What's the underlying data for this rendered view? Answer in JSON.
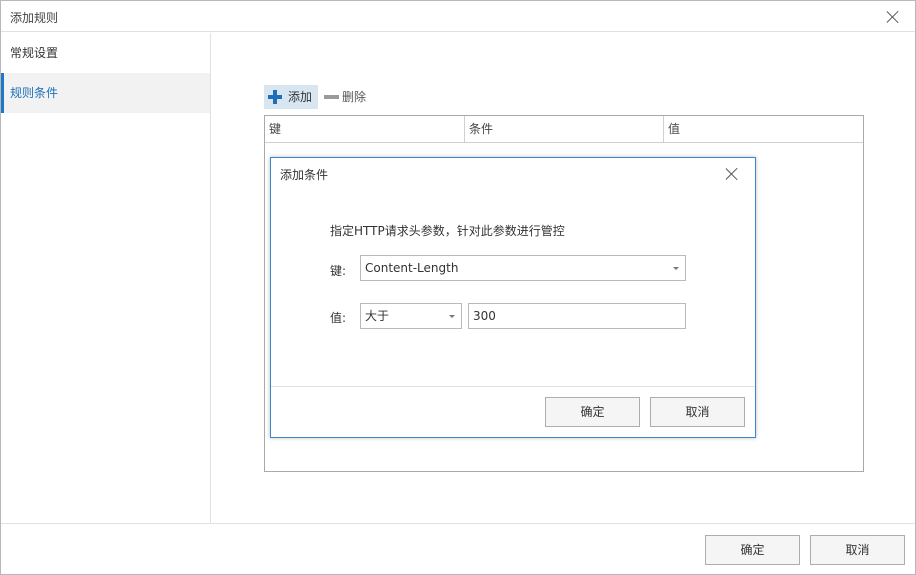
{
  "window": {
    "title": "添加规则",
    "close_icon": "close-icon"
  },
  "sidebar": {
    "items": [
      {
        "label": "常规设置",
        "active": false
      },
      {
        "label": "规则条件",
        "active": true
      }
    ]
  },
  "toolbar": {
    "add_label": "添加",
    "add_icon": "plus-icon",
    "delete_label": "删除",
    "delete_icon": "minus-icon"
  },
  "grid": {
    "columns": [
      "键",
      "条件",
      "值"
    ],
    "rows": []
  },
  "modal": {
    "title": "添加条件",
    "description": "指定HTTP请求头参数，针对此参数进行管控",
    "key_label": "键:",
    "key_value": "Content-Length",
    "value_label": "值:",
    "condition_value": "大于",
    "value_text": "300",
    "ok_label": "确定",
    "cancel_label": "取消"
  },
  "footer": {
    "ok_label": "确定",
    "cancel_label": "取消"
  },
  "colors": {
    "accent": "#1e78c8",
    "add_button_bg": "#d8e6f2",
    "modal_border": "#3b86c8"
  }
}
